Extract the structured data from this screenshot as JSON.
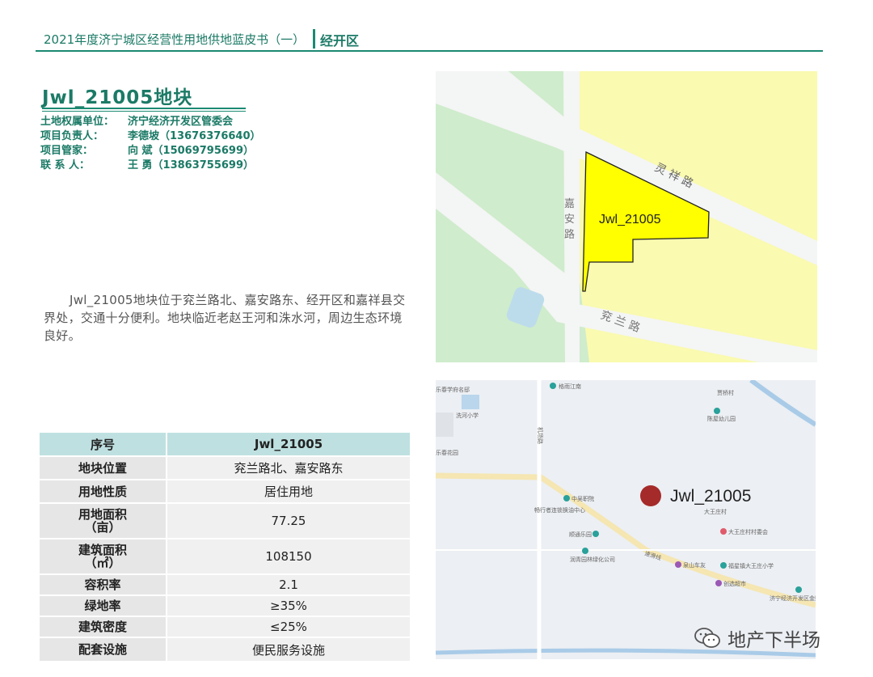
{
  "header": {
    "left_title": "2021年度济宁城区经营性用地供地蓝皮书（一）",
    "right_title": "经开区"
  },
  "parcel": {
    "title": "Jwl_21005地块",
    "contacts": [
      {
        "label": "土地权属单位：",
        "value": "济宁经济开发区管委会"
      },
      {
        "label": "项目负责人：",
        "value": "李德坡（13676376640）"
      },
      {
        "label": "项目管家：",
        "value": "向  斌（15069795699）"
      },
      {
        "label": "联 系 人：",
        "value": "王  勇（13863755699）"
      }
    ],
    "description": "Jwl_21005地块位于兖兰路北、嘉安路东、经开区和嘉祥县交界处，交通十分便利。地块临近老赵王河和洙水河，周边生态环境良好。"
  },
  "table": {
    "header": {
      "key": "序号",
      "value": "Jwl_21005"
    },
    "rows": [
      {
        "key": "地块位置",
        "value": "兖兰路北、嘉安路东"
      },
      {
        "key": "用地性质",
        "value": "居住用地"
      },
      {
        "key": "用地面积\n（亩）",
        "value": "77.25"
      },
      {
        "key": "建筑面积\n（㎡）",
        "value": "108150"
      },
      {
        "key": "容积率",
        "value": "2.1"
      },
      {
        "key": "绿地率",
        "value": "≥35%"
      },
      {
        "key": "建筑密度",
        "value": "≤25%"
      },
      {
        "key": "配套设施",
        "value": "便民服务设施"
      }
    ]
  },
  "map1": {
    "parcel_label": "Jwl_21005",
    "roads": {
      "lingxiang": "灵 祥 路",
      "jiaan": "嘉\n安\n路",
      "yanlan": "兖 兰 路"
    },
    "colors": {
      "green": "#cfeccc",
      "yellow": "#fafab0",
      "parcel": "#ffff00",
      "water": "#bcdcec"
    }
  },
  "map2": {
    "marker_label": "Jwl_21005",
    "marker_color": "#a52a2a",
    "poi": [
      "格雨江南",
      "贾桥村",
      "乐春学府名邸",
      "洗河小学",
      "陈屋幼儿园",
      "机场路",
      "中吴职院",
      "畅行者连锁换油中心",
      "顺通乐园",
      "大王庄村",
      "大王庄村村委会",
      "泉山车友",
      "福星镇大王庄小学",
      "润青园林绿化公司",
      "创选超市",
      "济宁经济开发区金熙机械有限公司",
      "速滑线",
      "乐春花园"
    ]
  },
  "watermark": {
    "text": "地产下半场",
    "icon": "wechat-icon"
  }
}
